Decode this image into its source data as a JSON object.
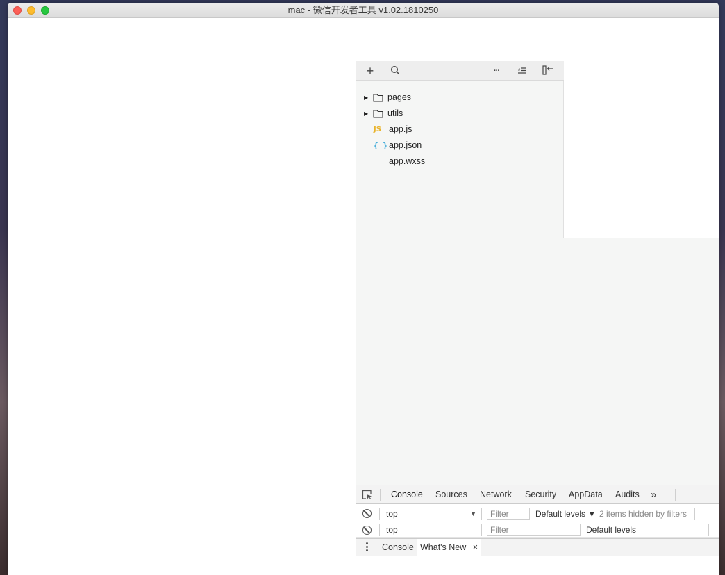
{
  "window": {
    "title": "mac - 微信开发者工具 v1.02.1810250"
  },
  "file_toolbar": {
    "add_icon": "plus-icon",
    "search_icon": "search-icon",
    "more_icon": "ellipsis-icon",
    "outline_icon": "sort-list-icon",
    "collapse_icon": "collapse-panel-icon",
    "add_glyph": "+",
    "more_glyph": "···"
  },
  "file_tree": {
    "items": [
      {
        "label": "pages",
        "type": "folder"
      },
      {
        "label": "utils",
        "type": "folder"
      },
      {
        "label": "app.js",
        "type": "js",
        "badge": "JS"
      },
      {
        "label": "app.json",
        "type": "json",
        "badge": "{ }"
      },
      {
        "label": "app.wxss",
        "type": "wxss"
      }
    ]
  },
  "devtools": {
    "tabs": [
      "Console",
      "Sources",
      "Network",
      "Security",
      "AppData",
      "Audits"
    ],
    "more_tabs": "»",
    "console_row": {
      "context": "top",
      "filter_placeholder": "Filter",
      "levels": "Default levels ▼",
      "hidden_note": "2 items hidden by filters"
    },
    "console_row2": {
      "context": "top",
      "filter_placeholder": "Filter",
      "levels": "Default levels"
    },
    "drawer": {
      "tabs": [
        "Console",
        "What's New"
      ],
      "close": "×"
    }
  },
  "colors": {
    "js_icon": "#e9b32a",
    "json_icon": "#3aa9d8",
    "panel_bg": "#f5f6f5"
  }
}
